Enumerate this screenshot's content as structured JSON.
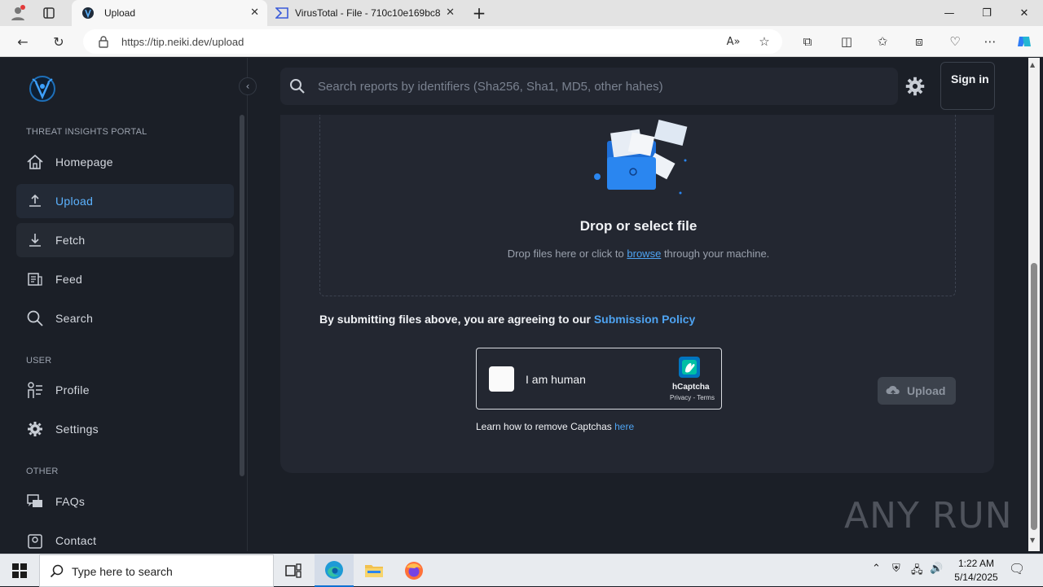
{
  "browser": {
    "tabs": [
      {
        "title": "Upload",
        "active": true
      },
      {
        "title": "VirusTotal - File - 710c10e169bc8",
        "active": false
      }
    ],
    "url": "https://tip.neiki.dev/upload"
  },
  "sidebar": {
    "sections": {
      "portal": "THREAT INSIGHTS PORTAL",
      "user": "USER",
      "other": "OTHER"
    },
    "items": [
      {
        "label": "Homepage",
        "icon": "home-icon"
      },
      {
        "label": "Upload",
        "icon": "upload-icon",
        "active": true
      },
      {
        "label": "Fetch",
        "icon": "download-icon"
      },
      {
        "label": "Feed",
        "icon": "feed-icon"
      },
      {
        "label": "Search",
        "icon": "search-icon"
      },
      {
        "label": "Profile",
        "icon": "profile-icon"
      },
      {
        "label": "Settings",
        "icon": "gear-icon"
      },
      {
        "label": "FAQs",
        "icon": "faq-icon"
      },
      {
        "label": "Contact",
        "icon": "contact-icon"
      }
    ]
  },
  "header": {
    "search_placeholder": "Search reports by identifiers (Sha256, Sha1, MD5, other hahes)",
    "signin_label": "Sign in"
  },
  "upload": {
    "drop_title": "Drop or select file",
    "drop_sub_before": "Drop files here or click to",
    "drop_sub_link": "browse",
    "drop_sub_after": "through your machine.",
    "agree_text": "By submitting files above, you are agreeing to our",
    "agree_link": "Submission Policy",
    "captcha_label": "I am human",
    "captcha_brand": "hCaptcha",
    "captcha_links": "Privacy - Terms",
    "remove_text": "Learn how to remove Captchas",
    "remove_link": "here",
    "upload_label": "Upload"
  },
  "watermark": "ANY RUN",
  "taskbar": {
    "search_placeholder": "Type here to search",
    "time": "1:22 AM",
    "date": "5/14/2025"
  },
  "colors": {
    "page_bg": "#1b1f27",
    "card_bg": "#232731",
    "accent": "#4ea3f1",
    "active_nav_text": "#5cb3ff"
  }
}
